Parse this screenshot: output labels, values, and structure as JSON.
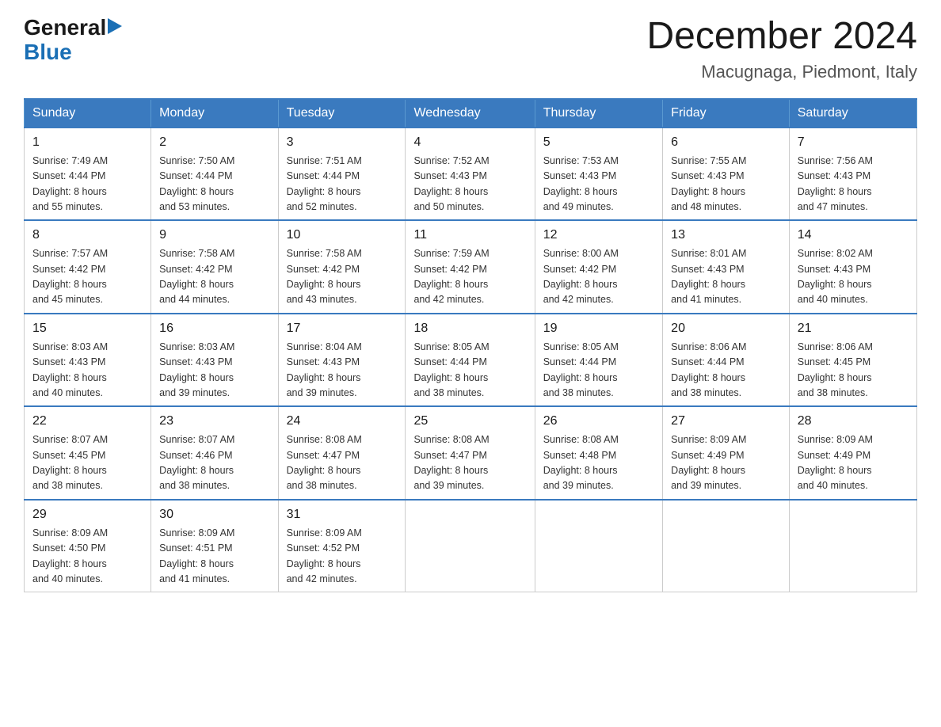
{
  "logo": {
    "general": "General",
    "blue": "Blue",
    "arrow": "▶"
  },
  "title": "December 2024",
  "location": "Macugnaga, Piedmont, Italy",
  "days_of_week": [
    "Sunday",
    "Monday",
    "Tuesday",
    "Wednesday",
    "Thursday",
    "Friday",
    "Saturday"
  ],
  "weeks": [
    [
      {
        "day": "1",
        "sunrise": "7:49 AM",
        "sunset": "4:44 PM",
        "daylight": "8 hours and 55 minutes."
      },
      {
        "day": "2",
        "sunrise": "7:50 AM",
        "sunset": "4:44 PM",
        "daylight": "8 hours and 53 minutes."
      },
      {
        "day": "3",
        "sunrise": "7:51 AM",
        "sunset": "4:44 PM",
        "daylight": "8 hours and 52 minutes."
      },
      {
        "day": "4",
        "sunrise": "7:52 AM",
        "sunset": "4:43 PM",
        "daylight": "8 hours and 50 minutes."
      },
      {
        "day": "5",
        "sunrise": "7:53 AM",
        "sunset": "4:43 PM",
        "daylight": "8 hours and 49 minutes."
      },
      {
        "day": "6",
        "sunrise": "7:55 AM",
        "sunset": "4:43 PM",
        "daylight": "8 hours and 48 minutes."
      },
      {
        "day": "7",
        "sunrise": "7:56 AM",
        "sunset": "4:43 PM",
        "daylight": "8 hours and 47 minutes."
      }
    ],
    [
      {
        "day": "8",
        "sunrise": "7:57 AM",
        "sunset": "4:42 PM",
        "daylight": "8 hours and 45 minutes."
      },
      {
        "day": "9",
        "sunrise": "7:58 AM",
        "sunset": "4:42 PM",
        "daylight": "8 hours and 44 minutes."
      },
      {
        "day": "10",
        "sunrise": "7:58 AM",
        "sunset": "4:42 PM",
        "daylight": "8 hours and 43 minutes."
      },
      {
        "day": "11",
        "sunrise": "7:59 AM",
        "sunset": "4:42 PM",
        "daylight": "8 hours and 42 minutes."
      },
      {
        "day": "12",
        "sunrise": "8:00 AM",
        "sunset": "4:42 PM",
        "daylight": "8 hours and 42 minutes."
      },
      {
        "day": "13",
        "sunrise": "8:01 AM",
        "sunset": "4:43 PM",
        "daylight": "8 hours and 41 minutes."
      },
      {
        "day": "14",
        "sunrise": "8:02 AM",
        "sunset": "4:43 PM",
        "daylight": "8 hours and 40 minutes."
      }
    ],
    [
      {
        "day": "15",
        "sunrise": "8:03 AM",
        "sunset": "4:43 PM",
        "daylight": "8 hours and 40 minutes."
      },
      {
        "day": "16",
        "sunrise": "8:03 AM",
        "sunset": "4:43 PM",
        "daylight": "8 hours and 39 minutes."
      },
      {
        "day": "17",
        "sunrise": "8:04 AM",
        "sunset": "4:43 PM",
        "daylight": "8 hours and 39 minutes."
      },
      {
        "day": "18",
        "sunrise": "8:05 AM",
        "sunset": "4:44 PM",
        "daylight": "8 hours and 38 minutes."
      },
      {
        "day": "19",
        "sunrise": "8:05 AM",
        "sunset": "4:44 PM",
        "daylight": "8 hours and 38 minutes."
      },
      {
        "day": "20",
        "sunrise": "8:06 AM",
        "sunset": "4:44 PM",
        "daylight": "8 hours and 38 minutes."
      },
      {
        "day": "21",
        "sunrise": "8:06 AM",
        "sunset": "4:45 PM",
        "daylight": "8 hours and 38 minutes."
      }
    ],
    [
      {
        "day": "22",
        "sunrise": "8:07 AM",
        "sunset": "4:45 PM",
        "daylight": "8 hours and 38 minutes."
      },
      {
        "day": "23",
        "sunrise": "8:07 AM",
        "sunset": "4:46 PM",
        "daylight": "8 hours and 38 minutes."
      },
      {
        "day": "24",
        "sunrise": "8:08 AM",
        "sunset": "4:47 PM",
        "daylight": "8 hours and 38 minutes."
      },
      {
        "day": "25",
        "sunrise": "8:08 AM",
        "sunset": "4:47 PM",
        "daylight": "8 hours and 39 minutes."
      },
      {
        "day": "26",
        "sunrise": "8:08 AM",
        "sunset": "4:48 PM",
        "daylight": "8 hours and 39 minutes."
      },
      {
        "day": "27",
        "sunrise": "8:09 AM",
        "sunset": "4:49 PM",
        "daylight": "8 hours and 39 minutes."
      },
      {
        "day": "28",
        "sunrise": "8:09 AM",
        "sunset": "4:49 PM",
        "daylight": "8 hours and 40 minutes."
      }
    ],
    [
      {
        "day": "29",
        "sunrise": "8:09 AM",
        "sunset": "4:50 PM",
        "daylight": "8 hours and 40 minutes."
      },
      {
        "day": "30",
        "sunrise": "8:09 AM",
        "sunset": "4:51 PM",
        "daylight": "8 hours and 41 minutes."
      },
      {
        "day": "31",
        "sunrise": "8:09 AM",
        "sunset": "4:52 PM",
        "daylight": "8 hours and 42 minutes."
      },
      null,
      null,
      null,
      null
    ]
  ],
  "labels": {
    "sunrise_prefix": "Sunrise: ",
    "sunset_prefix": "Sunset: ",
    "daylight_prefix": "Daylight: "
  }
}
